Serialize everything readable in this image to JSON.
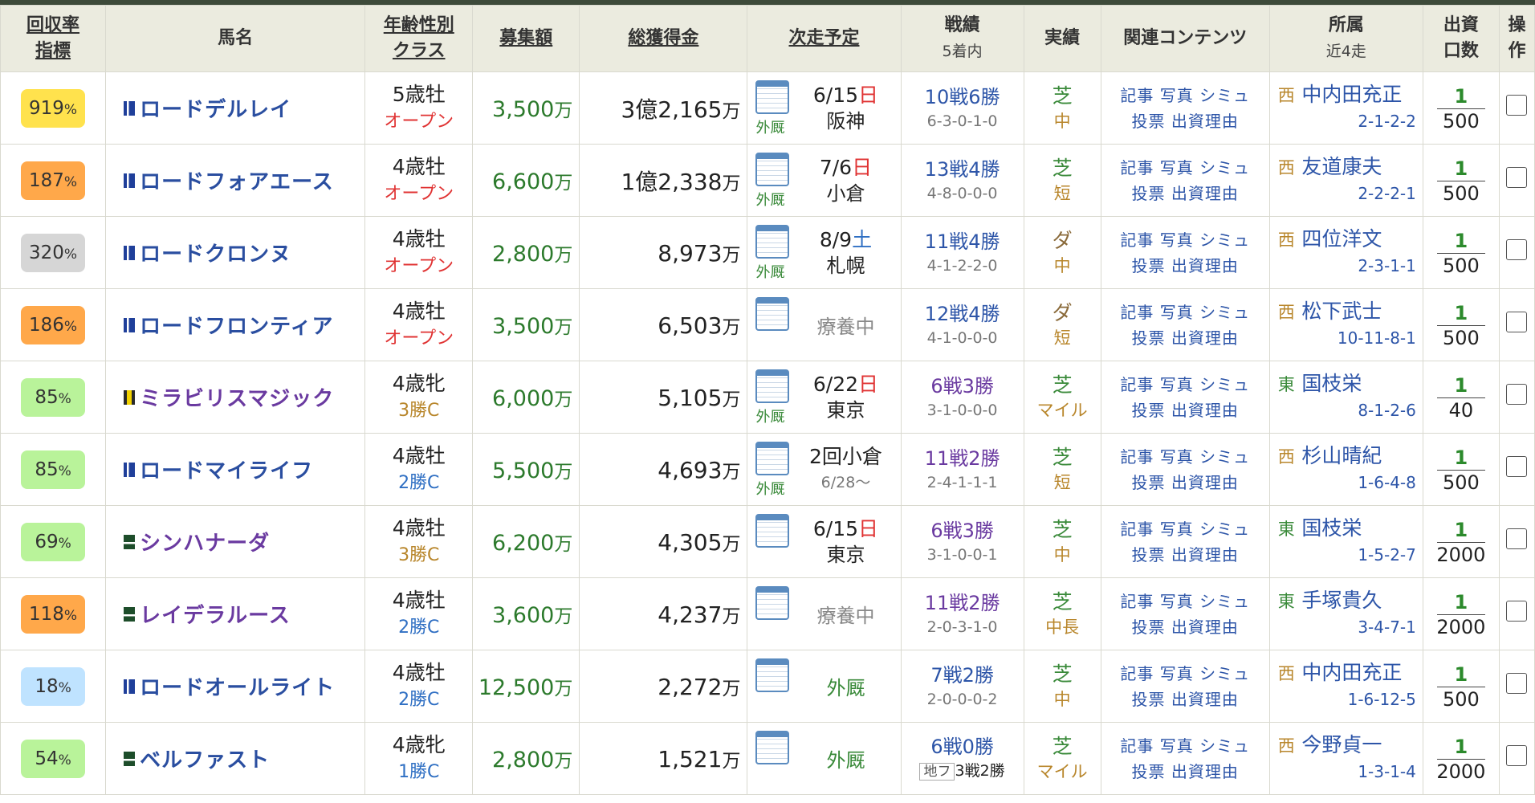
{
  "headers": {
    "rate_l1": "回収率",
    "rate_l2": "指標",
    "name": "馬名",
    "age_l1": "年齢性別",
    "age_l2": "クラス",
    "bosyu": "募集額",
    "total": "総獲得金",
    "next": "次走予定",
    "rec_l1": "戦績",
    "rec_l2": "5着内",
    "res": "実績",
    "rel": "関連コンテンツ",
    "stb_l1": "所属",
    "stb_l2": "近4走",
    "units_l1": "出資",
    "units_l2": "口数",
    "op_l1": "操",
    "op_l2": "作"
  },
  "links": {
    "a": "記事 写真 シミュ",
    "b": "投票 出資理由"
  },
  "rows": [
    {
      "rate": "919",
      "badge_color": "#ffe24d",
      "silk": "blue",
      "name": "ロードデルレイ",
      "purple": false,
      "age": "5歳牡",
      "cls": "オープン",
      "cls_color": "#e03333",
      "bosyu": "3,500",
      "total": "3億2,165",
      "next_type": "race",
      "gaikyu": "外厩",
      "date": "6/15",
      "dow": "日",
      "dow_cls": "sun",
      "track": "阪神",
      "rec": "10戦6勝",
      "rec_purple": false,
      "rec_detail": "6-3-0-1-0",
      "surface": "芝",
      "dist": "中",
      "region": "西",
      "trainer": "中内田充正",
      "last4": "2-1-2-2",
      "unit": "1",
      "units": "500"
    },
    {
      "rate": "187",
      "badge_color": "#ffa84a",
      "silk": "blue",
      "name": "ロードフォアエース",
      "purple": false,
      "age": "4歳牡",
      "cls": "オープン",
      "cls_color": "#e03333",
      "bosyu": "6,600",
      "total": "1億2,338",
      "next_type": "race",
      "gaikyu": "外厩",
      "date": "7/6",
      "dow": "日",
      "dow_cls": "sun",
      "track": "小倉",
      "rec": "13戦4勝",
      "rec_purple": false,
      "rec_detail": "4-8-0-0-0",
      "surface": "芝",
      "dist": "短",
      "region": "西",
      "trainer": "友道康夫",
      "last4": "2-2-2-1",
      "unit": "1",
      "units": "500"
    },
    {
      "rate": "320",
      "badge_color": "#d6d6d6",
      "silk": "blue",
      "name": "ロードクロンヌ",
      "purple": false,
      "age": "4歳牡",
      "cls": "オープン",
      "cls_color": "#e03333",
      "bosyu": "2,800",
      "total": "8,973",
      "next_type": "race",
      "gaikyu": "外厩",
      "date": "8/9",
      "dow": "土",
      "dow_cls": "sat",
      "track": "札幌",
      "rec": "11戦4勝",
      "rec_purple": false,
      "rec_detail": "4-1-2-2-0",
      "surface": "ダ",
      "dist": "中",
      "region": "西",
      "trainer": "四位洋文",
      "last4": "2-3-1-1",
      "unit": "1",
      "units": "500"
    },
    {
      "rate": "186",
      "badge_color": "#ffa84a",
      "silk": "blue",
      "name": "ロードフロンティア",
      "purple": false,
      "age": "4歳牡",
      "cls": "オープン",
      "cls_color": "#e03333",
      "bosyu": "3,500",
      "total": "6,503",
      "next_type": "status",
      "status": "療養中",
      "status_green": false,
      "rec": "12戦4勝",
      "rec_purple": false,
      "rec_detail": "4-1-0-0-0",
      "surface": "ダ",
      "dist": "短",
      "region": "西",
      "trainer": "松下武士",
      "last4": "10-11-8-1",
      "unit": "1",
      "units": "500"
    },
    {
      "rate": "85",
      "badge_color": "#b9f39a",
      "silk": "yellow",
      "name": "ミラビリスマジック",
      "purple": true,
      "age": "4歳牝",
      "cls": "3勝C",
      "cls_color": "#b8862b",
      "bosyu": "6,000",
      "total": "5,105",
      "next_type": "race",
      "gaikyu": "外厩",
      "date": "6/22",
      "dow": "日",
      "dow_cls": "sun",
      "track": "東京",
      "rec": "6戦3勝",
      "rec_purple": true,
      "rec_detail": "3-1-0-0-0",
      "surface": "芝",
      "dist": "マイル",
      "region": "東",
      "trainer": "国枝栄",
      "last4": "8-1-2-6",
      "unit": "1",
      "units": "40"
    },
    {
      "rate": "85",
      "badge_color": "#b9f39a",
      "silk": "blue",
      "name": "ロードマイライフ",
      "purple": false,
      "age": "4歳牡",
      "cls": "2勝C",
      "cls_color": "#2f6fc3",
      "bosyu": "5,500",
      "total": "4,693",
      "next_type": "race2",
      "gaikyu": "外厩",
      "race_name": "2回小倉",
      "race_date": "6/28～",
      "rec": "11戦2勝",
      "rec_purple": true,
      "rec_detail": "2-4-1-1-1",
      "surface": "芝",
      "dist": "短",
      "region": "西",
      "trainer": "杉山晴紀",
      "last4": "1-6-4-8",
      "unit": "1",
      "units": "500"
    },
    {
      "rate": "69",
      "badge_color": "#b9f39a",
      "silk": "green",
      "name": "シンハナーダ",
      "purple": true,
      "age": "4歳牡",
      "cls": "3勝C",
      "cls_color": "#b8862b",
      "bosyu": "6,200",
      "total": "4,305",
      "next_type": "race",
      "gaikyu": "",
      "date": "6/15",
      "dow": "日",
      "dow_cls": "sun",
      "track": "東京",
      "rec": "6戦3勝",
      "rec_purple": true,
      "rec_detail": "3-1-0-0-1",
      "surface": "芝",
      "dist": "中",
      "region": "東",
      "trainer": "国枝栄",
      "last4": "1-5-2-7",
      "unit": "1",
      "units": "2000"
    },
    {
      "rate": "118",
      "badge_color": "#ffa84a",
      "silk": "green",
      "name": "レイデラルース",
      "purple": true,
      "age": "4歳牡",
      "cls": "2勝C",
      "cls_color": "#2f6fc3",
      "bosyu": "3,600",
      "total": "4,237",
      "next_type": "status",
      "status": "療養中",
      "status_green": false,
      "rec": "11戦2勝",
      "rec_purple": true,
      "rec_detail": "2-0-3-1-0",
      "surface": "芝",
      "dist": "中長",
      "region": "東",
      "trainer": "手塚貴久",
      "last4": "3-4-7-1",
      "unit": "1",
      "units": "2000"
    },
    {
      "rate": "18",
      "badge_color": "#bfe3ff",
      "silk": "blue",
      "name": "ロードオールライト",
      "purple": false,
      "age": "4歳牡",
      "cls": "2勝C",
      "cls_color": "#2f6fc3",
      "bosyu": "12,500",
      "total": "2,272",
      "next_type": "status",
      "status": "外厩",
      "status_green": true,
      "rec": "7戦2勝",
      "rec_purple": false,
      "rec_detail": "2-0-0-0-2",
      "surface": "芝",
      "dist": "中",
      "region": "西",
      "trainer": "中内田充正",
      "last4": "1-6-12-5",
      "unit": "1",
      "units": "500"
    },
    {
      "rate": "54",
      "badge_color": "#b9f39a",
      "silk": "green",
      "name": "ベルファスト",
      "purple": false,
      "age": "4歳牝",
      "cls": "1勝C",
      "cls_color": "#2f6fc3",
      "bosyu": "2,800",
      "total": "1,521",
      "next_type": "status",
      "status": "外厩",
      "status_green": true,
      "rec": "6戦0勝",
      "rec_purple": false,
      "rec_tag": "地フ",
      "rec_detail": "3戦2勝",
      "surface": "芝",
      "dist": "マイル",
      "region": "西",
      "trainer": "今野貞一",
      "last4": "1-3-1-4",
      "unit": "1",
      "units": "2000"
    }
  ],
  "unit_labels": {
    "man": "万",
    "pct": "%"
  },
  "colors": {
    "green_text": "#2c7a2c",
    "blue_link": "#2d55a8",
    "header_bg": "#ebebdf",
    "topbar": "#3d4a3a"
  }
}
